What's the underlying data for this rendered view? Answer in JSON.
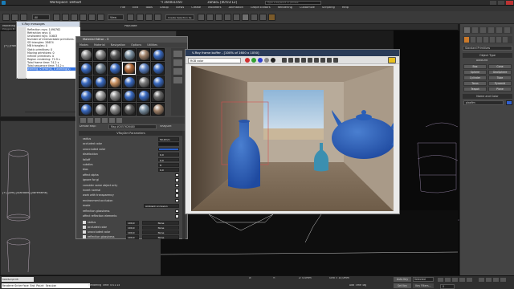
{
  "window": {
    "title": "Workspace: Default",
    "doc_info": "Ч 1600x1050",
    "record": "Запись [00:03:12]",
    "search_placeholder": "Type a keyword or phrase"
  },
  "menus": [
    "File",
    "Edit",
    "Tools",
    "Group",
    "Views",
    "Create",
    "Modifiers",
    "Animation",
    "Graph Editors",
    "Rendering",
    "Customize",
    "Scripting",
    "Help"
  ],
  "toolbar": {
    "filter_value": "All",
    "view_value": "View",
    "selection_set": "Create Selection Se"
  },
  "ribbon": {
    "modeling_tab": "Modeling",
    "populate_tab": "Populate",
    "polygon_label": "Polygon M"
  },
  "viewports": {
    "top_label": "[+] [Left] [Standard] [Wireframe]",
    "mid_label": "[+] [Left] [Standard] [Wireframe]",
    "bottom_label": "[+] [Front] [Standard] [Wireframe]"
  },
  "vray_messages": {
    "title": "V-Ray messages",
    "lines": [
      "Reflection rays: 1490762",
      "Refraction rays: 0",
      "Unshaded rays: 31603",
      "Number of intersectable primitives:",
      "  SD triangles: 28674",
      "  MB triangles: 0",
      "  Static primitives: 0",
      "  Moving primitives: 0",
      "  Infinite primitives: 0",
      "Region rendering: 72.9 s",
      "Total frame time: 74.2 s",
      "Total sequence time: 74.2 s",
      "warning: 0 error(s), 0 warning(s)"
    ]
  },
  "material_editor": {
    "title": "Material Editor - 3",
    "menus": [
      "Modes",
      "Material",
      "Navigation",
      "Options",
      "Utilities"
    ],
    "map_label": "Diffuse Map:",
    "map_value": "Map #2057626480",
    "map_type": "VRayDirt",
    "section_title": "VRayDirt Parameters",
    "params": [
      {
        "label": "radius",
        "value": "50,0mm"
      },
      {
        "label": "occluded color",
        "value": ""
      },
      {
        "label": "unoccluded color",
        "value": ""
      },
      {
        "label": "distribution",
        "value": "0,0"
      },
      {
        "label": "falloff",
        "value": "0,0"
      },
      {
        "label": "subdivs",
        "value": "8"
      },
      {
        "label": "bias",
        "value": "0,0"
      },
      {
        "label": "affect alpha",
        "value": ""
      },
      {
        "label": "ignore for gi",
        "value": ""
      },
      {
        "label": "consider same object only",
        "value": ""
      },
      {
        "label": "invert normal",
        "value": ""
      },
      {
        "label": "work with transparency",
        "value": ""
      },
      {
        "label": "environment occlusion",
        "value": ""
      },
      {
        "label": "mode",
        "value": "Ambient occlusion"
      },
      {
        "label": "reflection glossiness",
        "value": ""
      },
      {
        "label": "affect reflection elements",
        "value": ""
      }
    ],
    "maps_rows": [
      {
        "label": "radius",
        "amount": "100,0",
        "map": "None"
      },
      {
        "label": "occluded color",
        "amount": "100,0",
        "map": "None"
      },
      {
        "label": "unoccluded color",
        "amount": "100,0",
        "map": "None"
      },
      {
        "label": "reflection glossiness",
        "amount": "100,0",
        "map": "None"
      }
    ]
  },
  "vfb": {
    "title": "V-Ray frame buffer - [100% of 1600 x 1050]",
    "channel": "RGB color",
    "colors": {
      "red": "#d03030",
      "green": "#30a030",
      "blue": "#3040d0"
    }
  },
  "command_panel": {
    "dropdown": "Standard Primitives",
    "object_type": "Object Type",
    "autogrid": "AutoGrid",
    "buttons": [
      "Box",
      "Cone",
      "Sphere",
      "GeoSphere",
      "Cylinder",
      "Tube",
      "Torus",
      "Pyramid",
      "Teapot",
      "Plane"
    ],
    "name_color": "Name and Color",
    "name_value": "plasfim"
  },
  "status": {
    "left_script": "MAXScript Mi",
    "script_line": "RendererInterface End Paint Session",
    "rendering_time": "Rendering Time: 0:01:14",
    "x_value": "X:",
    "y_value": "Y:",
    "z_value": "Z: 0.0mm",
    "grid_value": "Grid = 10,0mm",
    "add_time_tag": "Add Time Tag",
    "auto_key": "Auto Key",
    "selected": "Selected",
    "set_key": "Set Key",
    "key_filters": "Key Filters...",
    "frame": "0"
  }
}
